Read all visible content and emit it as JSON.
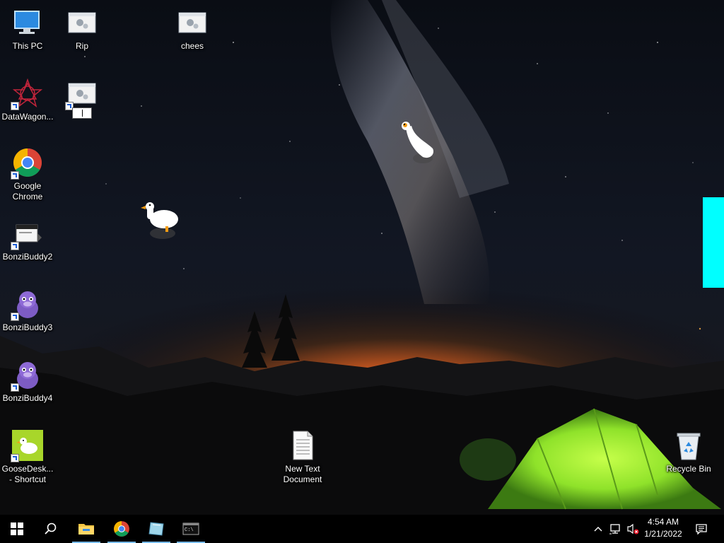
{
  "desktop_icons": [
    {
      "id": "this-pc",
      "label": "This PC",
      "shortcut": false
    },
    {
      "id": "rip",
      "label": "Rip",
      "shortcut": false
    },
    {
      "id": "chees",
      "label": "chees",
      "shortcut": false
    },
    {
      "id": "datawagon",
      "label": "DataWagon...",
      "shortcut": true
    },
    {
      "id": "new-folder-rename",
      "label": "",
      "shortcut": true
    },
    {
      "id": "google-chrome",
      "label": "Google\nChrome",
      "shortcut": true
    },
    {
      "id": "bonzibuddy2",
      "label": "BonziBuddy2",
      "shortcut": true
    },
    {
      "id": "bonzibuddy3",
      "label": "BonziBuddy3",
      "shortcut": true
    },
    {
      "id": "bonzibuddy4",
      "label": "BonziBuddy4",
      "shortcut": true
    },
    {
      "id": "goosedesktop",
      "label": "GooseDesk...\n- Shortcut",
      "shortcut": true
    },
    {
      "id": "new-text-document",
      "label": "New Text\nDocument",
      "shortcut": false
    },
    {
      "id": "recycle-bin",
      "label": "Recycle Bin",
      "shortcut": false
    }
  ],
  "taskbar": {
    "start_icon": "windows-logo-icon",
    "search_icon": "search-icon",
    "pinned": [
      {
        "name": "file-explorer",
        "icon": "folder-icon",
        "active": true
      },
      {
        "name": "google-chrome",
        "icon": "chrome-icon",
        "active": true
      },
      {
        "name": "app-window",
        "icon": "glass-window-icon",
        "active": true
      },
      {
        "name": "command-prompt",
        "icon": "terminal-icon",
        "active": true
      }
    ],
    "tray": {
      "icons": [
        "chevron-up-icon",
        "network-icon",
        "volume-muted-icon"
      ],
      "time": "4:54 AM",
      "date": "1/21/2022",
      "notification_icon": "notification-icon"
    }
  },
  "colors": {
    "accent_cyan": "#00ffff",
    "taskbar": "#000000",
    "tent_green": "#8fe22a",
    "horizon_orange": "#e06a1f"
  }
}
